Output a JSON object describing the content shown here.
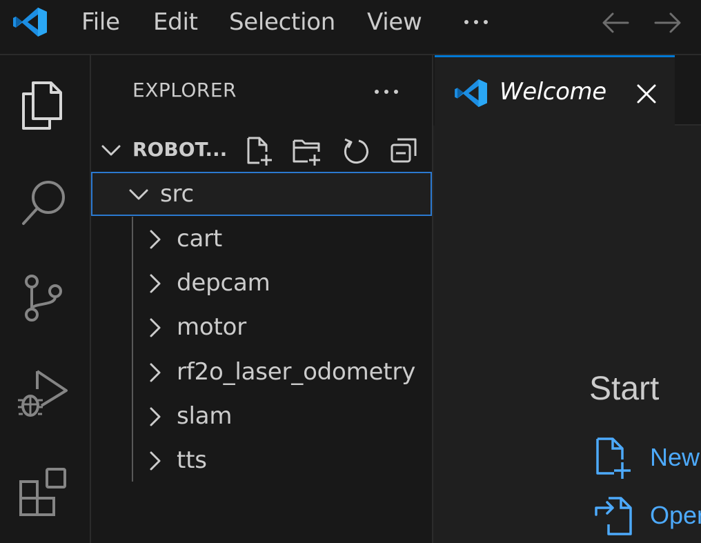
{
  "menu": {
    "items": [
      "File",
      "Edit",
      "Selection",
      "View"
    ]
  },
  "icons": {
    "app": "vscode-logo-icon",
    "more": "ellipsis-icon",
    "back": "arrow-left-icon",
    "forward": "arrow-right-icon",
    "activity": [
      "explorer-files-icon",
      "search-icon",
      "source-control-icon",
      "run-debug-icon",
      "extensions-icon"
    ]
  },
  "sidebar": {
    "title": "EXPLORER",
    "section_title": "ROBOT...",
    "actions": [
      "new-file-icon",
      "new-folder-icon",
      "refresh-icon",
      "collapse-all-icon"
    ],
    "root_folder": "src",
    "folders": [
      "cart",
      "depcam",
      "motor",
      "rf2o_laser_odometry",
      "slam",
      "tts"
    ]
  },
  "editor": {
    "tab_label": "Welcome",
    "start_title": "Start",
    "start_items": [
      "New",
      "Oper"
    ]
  },
  "colors": {
    "accent": "#0078d4",
    "link": "#4daafc",
    "selection_border": "#2b79d0",
    "vscode_blue": "#23a9f2"
  }
}
